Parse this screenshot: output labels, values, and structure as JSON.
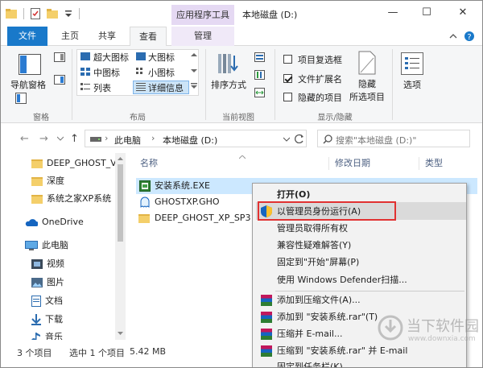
{
  "window": {
    "context_tab": "应用程序工具",
    "title": "本地磁盘 (D:)",
    "controls": {
      "minimize": "—",
      "maximize": "☐",
      "close": "✕"
    }
  },
  "tabs": {
    "file": "文件",
    "home": "主页",
    "share": "共享",
    "view": "查看",
    "manage": "管理"
  },
  "ribbon": {
    "panes": {
      "nav_pane": "导航窗格",
      "group": "窗格"
    },
    "layout": {
      "extra_large": "超大图标",
      "large": "大图标",
      "medium": "中图标",
      "small": "小图标",
      "list": "列表",
      "details": "详细信息",
      "group": "布局"
    },
    "current_view": {
      "sort": "排序方式",
      "group": "当前视图"
    },
    "show_hide": {
      "item_checkboxes": "项目复选框",
      "file_ext": "文件扩展名",
      "hidden_items": "隐藏的项目",
      "hide_selected_l1": "隐藏",
      "hide_selected_l2": "所选项目",
      "group": "显示/隐藏"
    },
    "options": "选项"
  },
  "address": {
    "this_pc": "此电脑",
    "arrow": "›",
    "drive": "本地磁盘 (D:)",
    "search_placeholder": "搜索\"本地磁盘 (D:)\""
  },
  "nav_pane": {
    "items": [
      "DEEP_GHOST_V",
      "深度",
      "系统之家XP系统",
      "OneDrive",
      "此电脑",
      "视频",
      "图片",
      "文档",
      "下载",
      "音乐"
    ]
  },
  "columns": {
    "name": "名称",
    "modified": "修改日期",
    "type": "类型"
  },
  "files": [
    {
      "name": "安装系统.EXE"
    },
    {
      "name": "GHOSTXP.GHO"
    },
    {
      "name": "DEEP_GHOST_XP_SP3"
    }
  ],
  "status": {
    "count": "3 个项目",
    "selected": "选中 1 个项目",
    "size": "5.42 MB"
  },
  "context_menu": {
    "items": [
      "打开(O)",
      "以管理员身份运行(A)",
      "管理员取得所有权",
      "兼容性疑难解答(Y)",
      "固定到\"开始\"屏幕(P)",
      "使用 Windows Defender扫描...",
      "添加到压缩文件(A)...",
      "添加到 \"安装系统.rar\"(T)",
      "压缩并 E-mail...",
      "压缩到 \"安装系统.rar\" 并 E-mail",
      "固定到任务栏(K)"
    ]
  },
  "watermark": {
    "text": "当下软件园",
    "url": "www.downxia.com"
  },
  "colors": {
    "accent": "#1979ca",
    "highlight_box": "#e13232",
    "selection": "#cce8ff"
  }
}
